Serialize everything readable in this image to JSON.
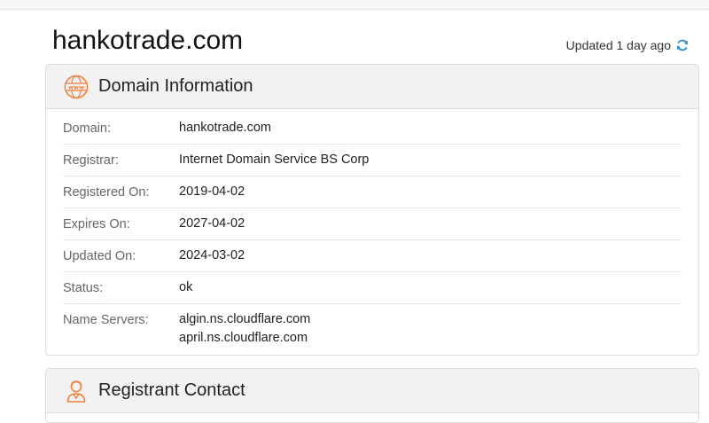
{
  "page": {
    "site_title": "hankotrade.com",
    "updated_text": "Updated 1 day ago"
  },
  "colors": {
    "accent_orange": "#f0803c",
    "refresh_blue": "#2b8fd6",
    "header_bg": "#f2f2f2"
  },
  "domain_info": {
    "title": "Domain Information",
    "icon": "www-globe-icon",
    "rows": [
      {
        "label": "Domain:",
        "value": "hankotrade.com"
      },
      {
        "label": "Registrar:",
        "value": "Internet Domain Service BS Corp"
      },
      {
        "label": "Registered On:",
        "value": "2019-04-02"
      },
      {
        "label": "Expires On:",
        "value": "2027-04-02"
      },
      {
        "label": "Updated On:",
        "value": "2024-03-02"
      },
      {
        "label": "Status:",
        "value": "ok"
      }
    ],
    "name_servers": {
      "label": "Name Servers:",
      "values": [
        "algin.ns.cloudflare.com",
        "april.ns.cloudflare.com"
      ]
    }
  },
  "registrant": {
    "title": "Registrant Contact",
    "icon": "person-icon"
  }
}
